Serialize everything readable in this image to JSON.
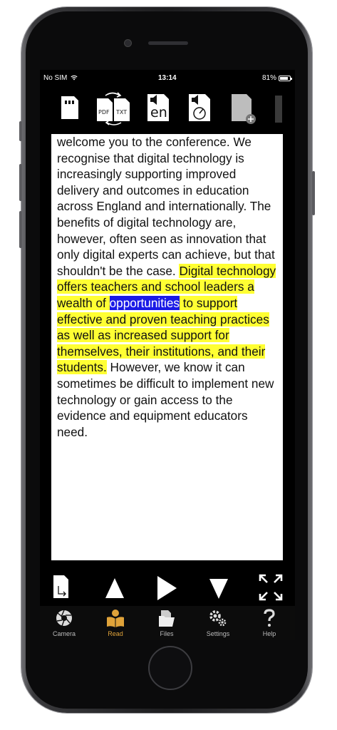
{
  "status": {
    "carrier": "No SIM",
    "time": "13:14",
    "battery": "81%",
    "battery_level": 0.81
  },
  "toolbar": {
    "items": [
      {
        "name": "sd-card-icon"
      },
      {
        "name": "pdf-txt-convert-icon",
        "labels": [
          "PDF",
          "TXT"
        ]
      },
      {
        "name": "language-icon",
        "label": "en"
      },
      {
        "name": "speed-icon"
      },
      {
        "name": "new-document-icon"
      }
    ]
  },
  "document": {
    "before": "welcome you to the conference. We recognise that digital technology is increasingly supporting improved delivery and outcomes in education across England and internationally. The benefits of digital technology are, however, often seen as innovation that only digital experts can achieve, but that shouldn't be the case. ",
    "highlight_start": "Digital technology offers teachers and school leaders a wealth of ",
    "current_word": "opportunities",
    "highlight_end": " to support effective and proven teaching practices as well as increased support for themselves, their institutions, and their students.",
    "after": " However, we know it can sometimes be difficult to implement new technology or gain access to the evidence and equipment educators need."
  },
  "colors": {
    "highlight": "#ffff33",
    "current_word_bg": "#1a1ae6",
    "active_tab": "#e0a33a"
  },
  "controls": [
    "page-export-icon",
    "previous-arrow-icon",
    "play-icon",
    "next-arrow-icon",
    "fullscreen-icon"
  ],
  "tabs": [
    {
      "label": "Camera",
      "icon": "camera-aperture-icon"
    },
    {
      "label": "Read",
      "icon": "reading-person-icon",
      "active": true
    },
    {
      "label": "Files",
      "icon": "files-icon"
    },
    {
      "label": "Settings",
      "icon": "gears-icon"
    },
    {
      "label": "Help",
      "icon": "question-icon"
    }
  ]
}
